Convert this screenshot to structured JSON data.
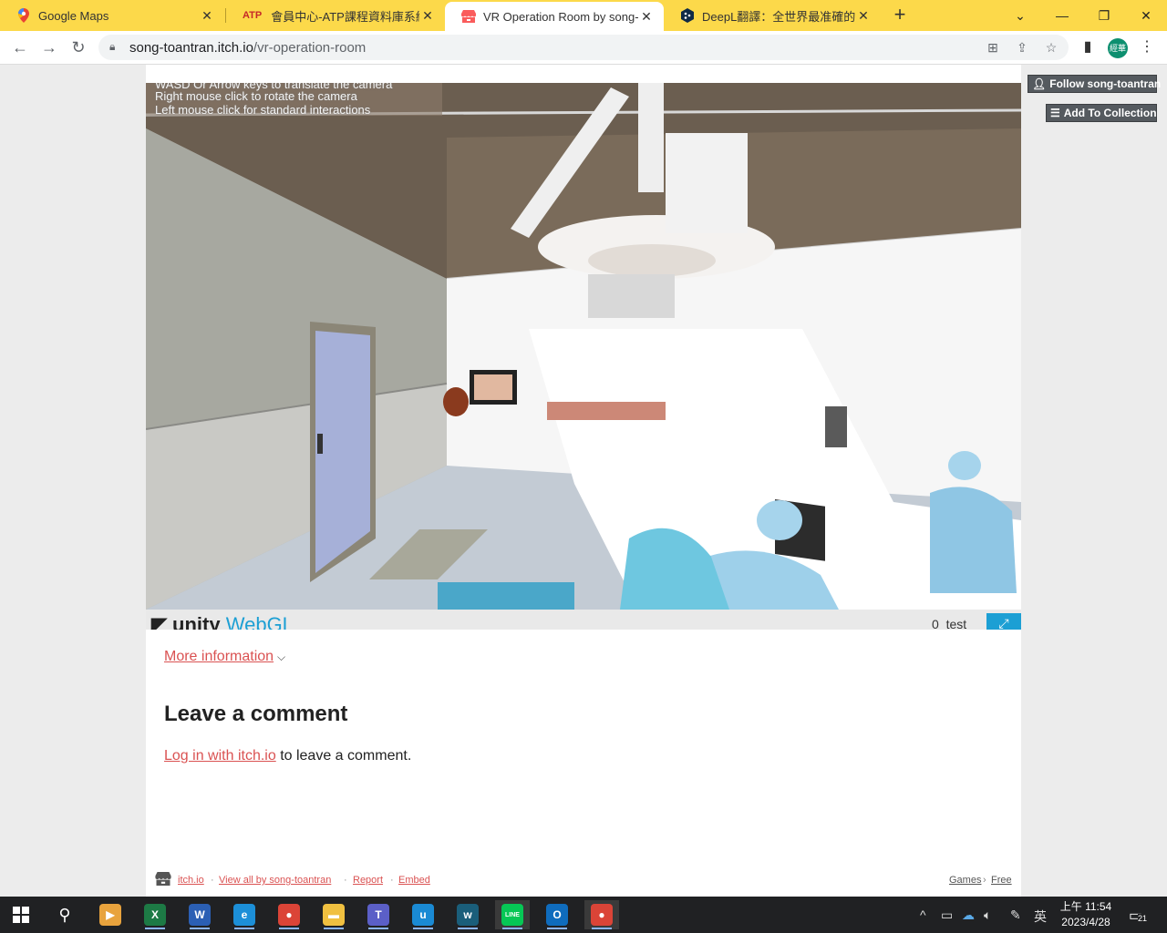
{
  "browser": {
    "tabs": [
      {
        "title": "Google Maps",
        "icon": "google-maps-pin-icon"
      },
      {
        "title": "會員中心-ATP課程資料庫系統 | 教",
        "icon": "atp-logo-icon",
        "icon_text": "ATP"
      },
      {
        "title": "VR Operation Room by song-to",
        "icon": "itchio-icon",
        "active": true
      },
      {
        "title": "DeepL翻譯：全世界最准確的翻",
        "icon": "deepl-icon"
      }
    ],
    "url_host": "song-toantran.itch.io",
    "url_path": "/vr-operation-room",
    "profile_label": "經華"
  },
  "page": {
    "follow_label": "Follow song-toantran",
    "collection_label": "Add To Collection",
    "game": {
      "instructions": [
        "WASD Or Arrow keys to translate the camera",
        "Right mouse click to rotate the camera",
        "Left mouse click for standard interactions"
      ],
      "unity_logo": "unity",
      "unity_webgl": "WebGL",
      "unity_title": "0_test",
      "fullscreen_icon": "fullscreen-icon"
    },
    "more_info_label": "More information",
    "comment_heading": "Leave a comment",
    "login_link": "Log in with itch.io",
    "login_suffix": "to leave a comment.",
    "footer": {
      "links": [
        "itch.io",
        "View all by song-toantran",
        "Report",
        "Embed"
      ],
      "separator": "·",
      "right_links": [
        "Games",
        "Free"
      ],
      "right_separator": "›"
    }
  },
  "taskbar": {
    "apps": [
      {
        "name": "media-player-icon",
        "color": "#e8a33d",
        "glyph": "▶"
      },
      {
        "name": "excel-icon",
        "color": "#1d7a45",
        "glyph": "X"
      },
      {
        "name": "word-icon",
        "color": "#2b5fb4",
        "glyph": "W"
      },
      {
        "name": "edge-icon",
        "color": "#1c8fd8",
        "glyph": "e"
      },
      {
        "name": "chrome-icon",
        "color": "#db4437",
        "glyph": "●"
      },
      {
        "name": "file-explorer-icon",
        "color": "#f0c040",
        "glyph": "▬"
      },
      {
        "name": "teams-icon",
        "color": "#5b5fc7",
        "glyph": "T"
      },
      {
        "name": "app-u-icon",
        "color": "#1a8ad4",
        "glyph": "u"
      },
      {
        "name": "webex-icon",
        "color": "#1a5e7a",
        "glyph": "w"
      },
      {
        "name": "line-icon",
        "color": "#06c755",
        "glyph": "LINE"
      },
      {
        "name": "outlook-icon",
        "color": "#0f6cbd",
        "glyph": "O"
      },
      {
        "name": "chrome-profile-icon",
        "color": "#db4437",
        "glyph": "●"
      }
    ],
    "ime": "英",
    "time": "上午 11:54",
    "date": "2023/4/28",
    "notifications": "21"
  }
}
